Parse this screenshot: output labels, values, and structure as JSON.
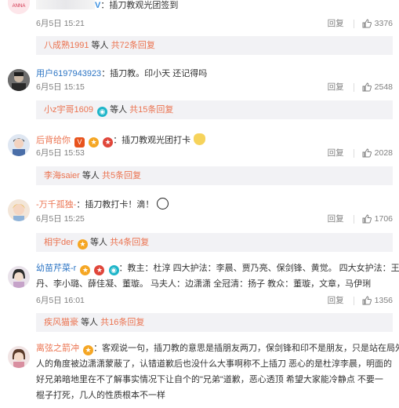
{
  "comments": [
    {
      "id": "c0",
      "text_prefix": "V",
      "text": "：插刀教观光团签到",
      "time": "6月5日 15:21",
      "reply_label": "回复",
      "likes": "3376",
      "sub": {
        "name": "八成熟1991",
        "middle": "等人",
        "count": "共72条回复"
      }
    },
    {
      "id": "c1",
      "user": "用户6197943923",
      "text": "：插刀教。印小天 还记得吗",
      "time": "6月5日 15:15",
      "reply_label": "回复",
      "likes": "2548",
      "sub": {
        "name": "小z宇哥1609",
        "middle": "等人",
        "count": "共15条回复"
      }
    },
    {
      "id": "c2",
      "user": "后背给你",
      "text": "：插刀教观光团打卡",
      "time": "6月5日 15:53",
      "reply_label": "回复",
      "likes": "2028",
      "sub": {
        "name": "李海saier",
        "middle": "等人",
        "count": "共5条回复"
      }
    },
    {
      "id": "c3",
      "user": "-万千孤独-",
      "text": "：插刀教打卡！滴！",
      "time": "6月5日 15:25",
      "reply_label": "回复",
      "likes": "1706",
      "sub": {
        "name": "相宇der",
        "middle": "等人",
        "count": "共4条回复"
      }
    },
    {
      "id": "c4",
      "user": "幼苗芹菜-r",
      "text_line1": "：教主：杜淳 四大护法：李晨、贾乃亮、保剑锋、黄觉。 四大女护法：王珞",
      "text_line2": "丹、李小璐、薛佳凝、董璇。 马夫人：边潇潇 全冠清：扬子 教众：董璇，文章，马伊琍",
      "time": "6月5日 16:01",
      "reply_label": "回复",
      "likes": "1356",
      "sub": {
        "name": "疾风猫豪",
        "middle": "等人",
        "count": "共16条回复"
      }
    },
    {
      "id": "c5",
      "user": "离弦之箭冲",
      "text_line1": "：客观说一句，插刀教的意思是插朋友两刀，保剑锋和印不是朋友，只是站在局外",
      "text_line2": "人的角度被边潇潇蒙蔽了，认错道歉后也没什么大事啊称不上插刀 恶心的是杜淳李晨，明面的",
      "text_line3": "好兄弟暗地里在不了解事实情况下让自个的\"兄弟\"道歉，恶心透顶 希望大家能冷静点 不要一",
      "text_line4": "棍子打死，几人的性质根本不一样"
    }
  ],
  "colors": {
    "username": "#eb7350",
    "subbox_bg": "#f2f2f5",
    "meta": "#808080"
  }
}
